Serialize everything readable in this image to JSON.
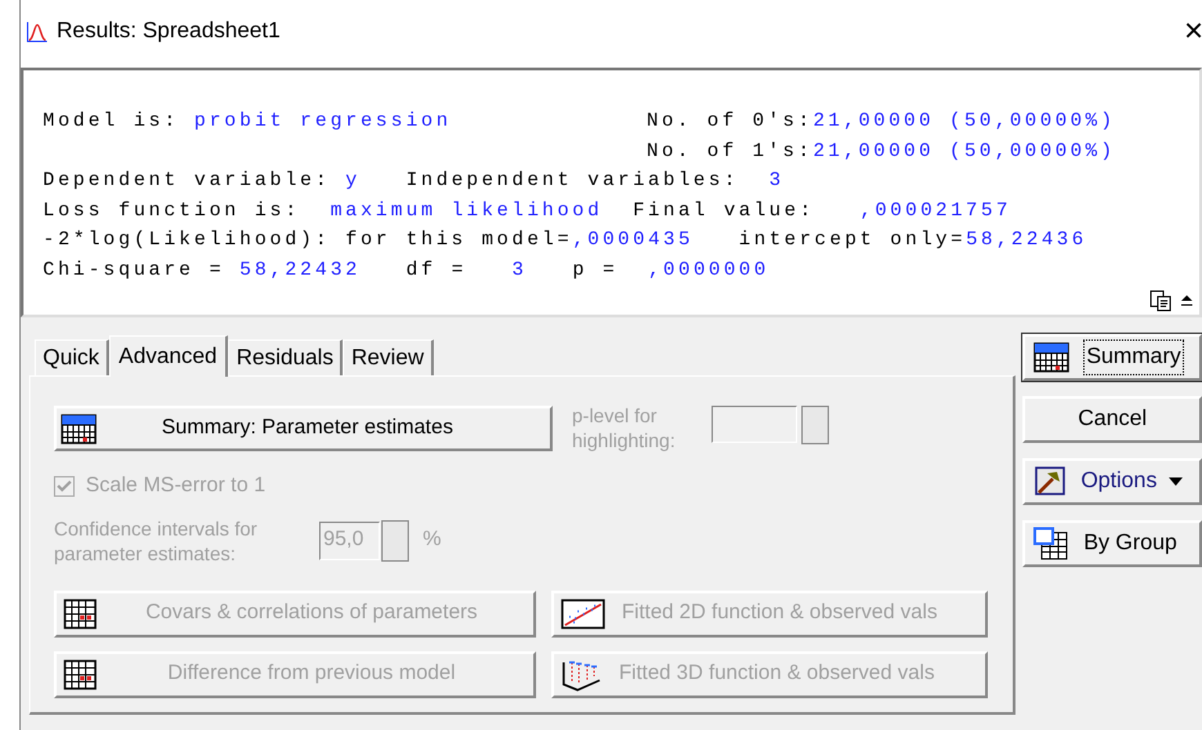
{
  "window": {
    "title": "Results: Spreadsheet1",
    "close": "×"
  },
  "output": {
    "lines": [
      {
        "segments": [
          {
            "text": "Model is: ",
            "kind": "label"
          },
          {
            "text": "probit regression",
            "kind": "value"
          }
        ],
        "right": [
          {
            "text": "No. of 0's:",
            "kind": "label"
          },
          {
            "text": "21,00000 (50,00000%)",
            "kind": "value"
          }
        ]
      },
      {
        "right": [
          {
            "text": "No. of 1's:",
            "kind": "label"
          },
          {
            "text": "21,00000 (50,00000%)",
            "kind": "value"
          }
        ]
      },
      {
        "segments": [
          {
            "text": "Dependent variable: ",
            "kind": "label"
          },
          {
            "text": "y",
            "kind": "value"
          },
          {
            "text": "   Independent variables:  ",
            "kind": "label"
          },
          {
            "text": "3",
            "kind": "value"
          }
        ]
      },
      {
        "segments": [
          {
            "text": "Loss function is:  ",
            "kind": "label"
          },
          {
            "text": "maximum likelihood",
            "kind": "value"
          },
          {
            "text": "  Final value:   ",
            "kind": "label"
          },
          {
            "text": ",000021757",
            "kind": "value"
          }
        ]
      },
      {
        "segments": [
          {
            "text": "-2*log(Likelihood): for this model=",
            "kind": "label"
          },
          {
            "text": ",0000435",
            "kind": "value"
          },
          {
            "text": "   intercept only=",
            "kind": "label"
          },
          {
            "text": "58,22436",
            "kind": "value"
          }
        ]
      },
      {
        "segments": [
          {
            "text": "Chi-square = ",
            "kind": "label"
          },
          {
            "text": "58,22432",
            "kind": "value"
          },
          {
            "text": "   df =   ",
            "kind": "label"
          },
          {
            "text": "3",
            "kind": "value"
          },
          {
            "text": "   p =  ",
            "kind": "label"
          },
          {
            "text": ",0000000",
            "kind": "value"
          }
        ]
      }
    ]
  },
  "tabs": [
    {
      "label": "Quick",
      "selected": false
    },
    {
      "label": "Advanced",
      "selected": true
    },
    {
      "label": "Residuals",
      "selected": false
    },
    {
      "label": "Review",
      "selected": false
    }
  ],
  "summary_button": {
    "label": "Summary: Parameter estimates",
    "disabled": false
  },
  "p_level": {
    "label": "p-level for highlighting:",
    "disabled": true
  },
  "scale_checkbox": {
    "label": "Scale MS-error to 1",
    "checked": true,
    "disabled": true
  },
  "confidence": {
    "label": "Confidence intervals for parameter estimates:",
    "value": "95,0",
    "unit": "%",
    "disabled": true
  },
  "action_buttons": [
    {
      "label": "Covars & correlations of parameters",
      "kind": "table",
      "disabled": true
    },
    {
      "label": "Fitted 2D function & observed vals",
      "kind": "plot2d",
      "disabled": true
    },
    {
      "label": "Difference from previous model",
      "kind": "table",
      "disabled": true
    },
    {
      "label": "Fitted 3D function & observed vals",
      "kind": "plot3d",
      "disabled": true
    }
  ],
  "side_buttons": [
    {
      "label": "Summary",
      "kind": "summary",
      "focused": true
    },
    {
      "label": "Cancel",
      "kind": "plain",
      "focused": false
    },
    {
      "label": "Options",
      "kind": "menu",
      "focused": false
    },
    {
      "label": "By Group",
      "kind": "bygroup",
      "focused": false
    }
  ]
}
